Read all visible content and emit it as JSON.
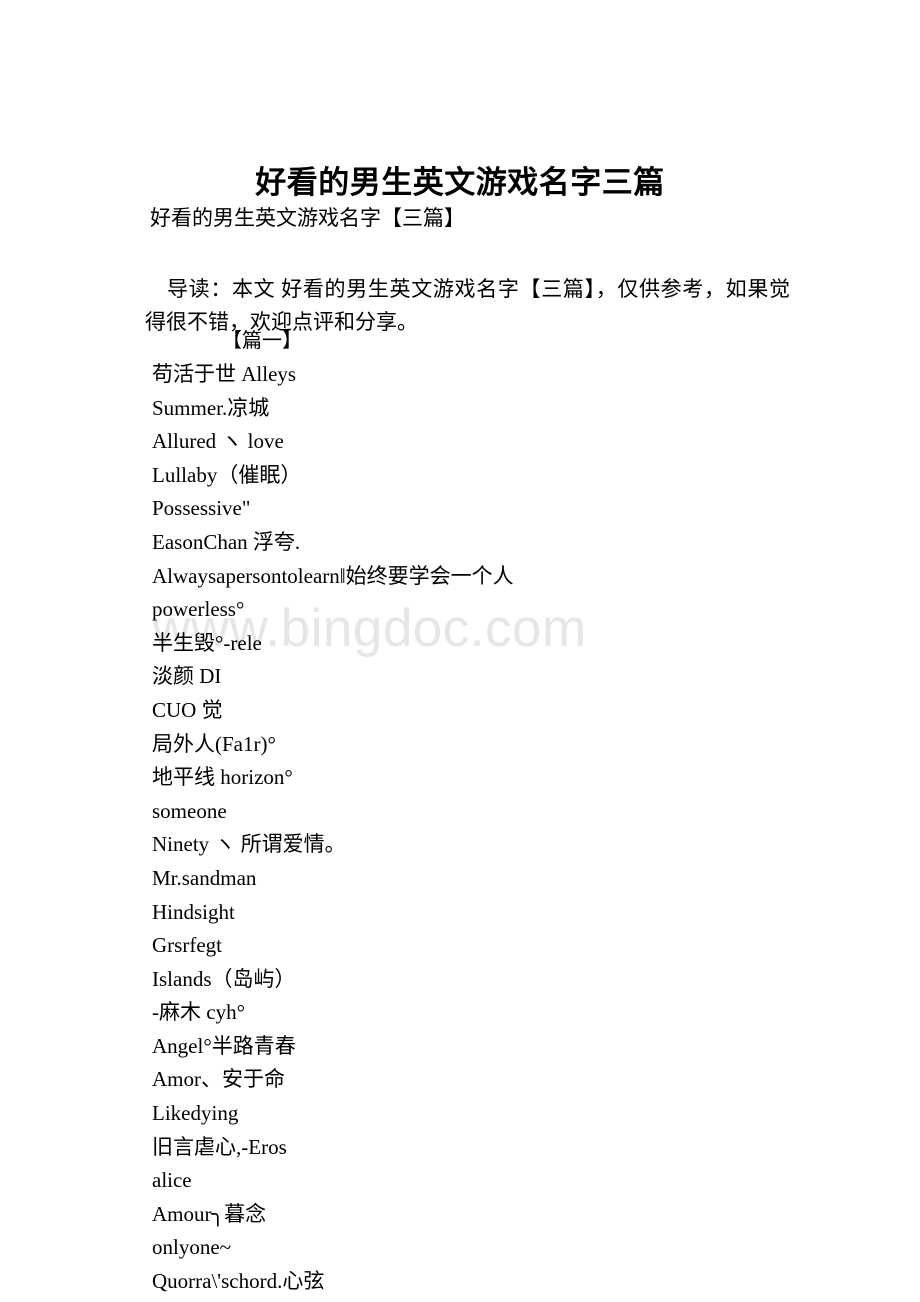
{
  "document": {
    "title": "好看的男生英文游戏名字三篇",
    "subtitle": "好看的男生英文游戏名字【三篇】",
    "lead": "导读：本文 好看的男生英文游戏名字【三篇】，仅供参考，如果觉得很不错，欢迎点评和分享。",
    "section_heading": "【篇一】",
    "watermark": "www.bingdoc.com",
    "watermark_color": "#e6e6e6",
    "text_color": "#000000",
    "background_color": "#ffffff"
  },
  "names": [
    "苟活于世 Alleys",
    "Summer.凉城",
    "Allured ヽ love",
    "Lullaby（催眠）",
    "Possessive\"",
    "EasonChan 浮夸.",
    "Alwaysapersontolearn‖始终要学会一个人",
    "powerless°",
    "半生毁°-rele",
    "淡颜 DI",
    "CUO 觉",
    "局外人(Fa1r)°",
    "地平线 horizon°",
    "someone",
    "Ninety ヽ 所谓爱情。",
    "Mr.sandman",
    "Hindsight",
    "Grsrfegt",
    "Islands（岛屿）",
    "-麻木 cyh°",
    "Angel°半路青春",
    "Amor、安于命",
    "Likedying",
    "旧言虐心,-Eros",
    "alice",
    "Amour╮暮念",
    "onlyone~",
    "Quorra\\'schord.心弦"
  ]
}
